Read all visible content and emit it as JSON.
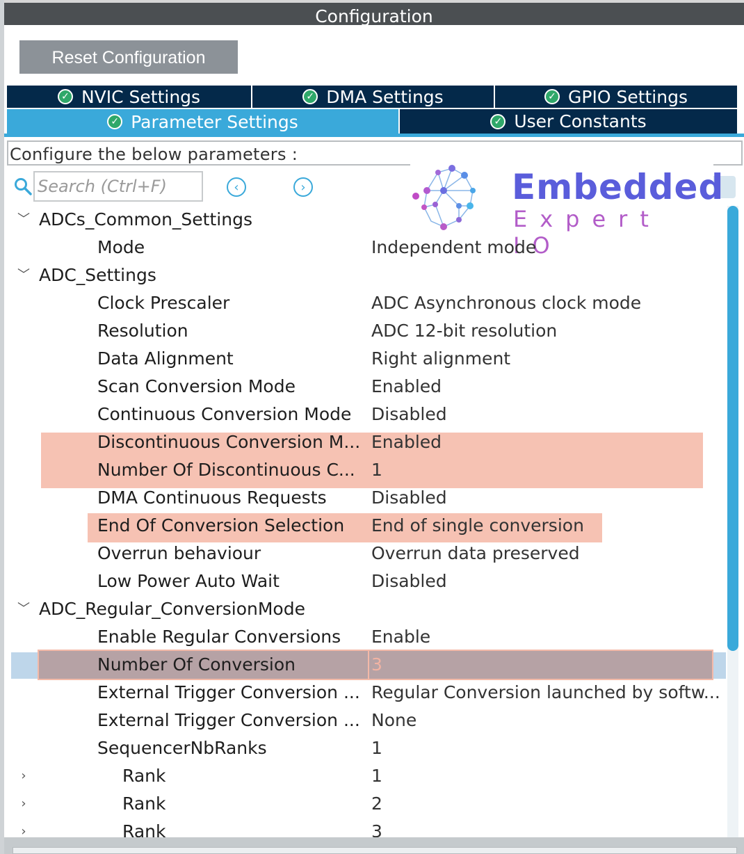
{
  "window": {
    "title": "Configuration"
  },
  "toolbar": {
    "reset_label": "Reset Configuration"
  },
  "tabs": [
    {
      "label": "NVIC Settings",
      "active": false
    },
    {
      "label": "DMA Settings",
      "active": false
    },
    {
      "label": "GPIO Settings",
      "active": false
    },
    {
      "label": "Parameter Settings",
      "active": true
    },
    {
      "label": "User Constants",
      "active": false
    }
  ],
  "description": "Configure the below parameters :",
  "search": {
    "placeholder": "Search (Ctrl+F)",
    "value": ""
  },
  "logo": {
    "title": "Embedded",
    "subtitle": "Expert IO"
  },
  "tree": [
    {
      "name": "ADCs_Common_Settings",
      "value": "",
      "level": 0,
      "toggle": "expanded"
    },
    {
      "name": "Mode",
      "value": "Independent mode",
      "level": 1
    },
    {
      "name": "ADC_Settings",
      "value": "",
      "level": 0,
      "toggle": "expanded"
    },
    {
      "name": "Clock Prescaler",
      "value": "ADC Asynchronous clock mode",
      "level": 1
    },
    {
      "name": "Resolution",
      "value": "ADC 12-bit resolution",
      "level": 1
    },
    {
      "name": "Data Alignment",
      "value": "Right alignment",
      "level": 1
    },
    {
      "name": "Scan Conversion Mode",
      "value": "Enabled",
      "level": 1
    },
    {
      "name": "Continuous Conversion Mode",
      "value": "Disabled",
      "level": 1
    },
    {
      "name": "Discontinuous Conversion M...",
      "value": "Enabled",
      "level": 1
    },
    {
      "name": "Number Of Discontinuous C...",
      "value": "1",
      "level": 1
    },
    {
      "name": "DMA Continuous Requests",
      "value": "Disabled",
      "level": 1
    },
    {
      "name": "End Of Conversion Selection",
      "value": "End of single conversion",
      "level": 1
    },
    {
      "name": "Overrun behaviour",
      "value": "Overrun data preserved",
      "level": 1
    },
    {
      "name": "Low Power Auto Wait",
      "value": "Disabled",
      "level": 1
    },
    {
      "name": "ADC_Regular_ConversionMode",
      "value": "",
      "level": 0,
      "toggle": "expanded"
    },
    {
      "name": "Enable Regular Conversions",
      "value": "Enable",
      "level": 1
    },
    {
      "name": "Number Of Conversion",
      "value": "3",
      "level": 1,
      "selected": true
    },
    {
      "name": "External Trigger Conversion ...",
      "value": "Regular Conversion launched by softw...",
      "level": 1
    },
    {
      "name": "External Trigger Conversion ...",
      "value": "None",
      "level": 1
    },
    {
      "name": "SequencerNbRanks",
      "value": "1",
      "level": 1
    },
    {
      "name": "Rank",
      "value": "1",
      "level": 2,
      "toggle": "collapsed"
    },
    {
      "name": "Rank",
      "value": "2",
      "level": 2,
      "toggle": "collapsed"
    },
    {
      "name": "Rank",
      "value": "3",
      "level": 2,
      "toggle": "collapsed"
    }
  ],
  "colors": {
    "tab_inactive": "#04294a",
    "tab_active": "#3aa9da",
    "highlight": "#f6c2b3",
    "selection": "#bed6ea"
  }
}
